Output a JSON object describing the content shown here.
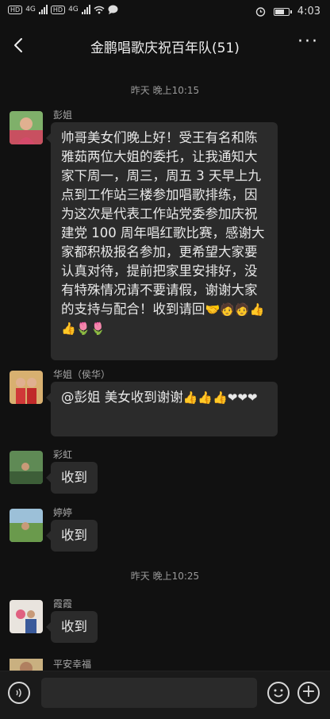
{
  "status_bar": {
    "sim1": "HD",
    "sim2": "HD",
    "network1": "4G",
    "network2": "4G",
    "time": "4:03",
    "icons": [
      "hd-icon",
      "signal-icon",
      "wifi-icon",
      "message-icon",
      "alarm-icon",
      "battery-icon"
    ]
  },
  "header": {
    "title": "金鹏唱歌庆祝百年队(51)",
    "back_icon": "chevron-left-icon",
    "more_label": "···"
  },
  "timestamps": [
    "昨天 晚上10:15",
    "昨天 晚上10:25"
  ],
  "messages": [
    {
      "sender": "彭姐",
      "text": "帅哥美女们晚上好！受王有名和陈雅茹两位大姐的委托，让我通知大家下周一，周三，周五 3 天早上九点到工作站三楼参加唱歌排练，因为这次是代表工作站党委参加庆祝建党 100 周年唱红歌比赛，感谢大家都积极报名参加，更希望大家要认真对待，提前把家里安排好，没有特殊情况请不要请假，谢谢大家的支持与配合！收到请回",
      "emoji": "🤝🧑🧑👍👍🌷🌷"
    },
    {
      "sender": "华姐（侯华）",
      "text": "@彭姐  美女收到谢谢",
      "emoji": "👍👍👍❤❤❤"
    },
    {
      "sender": "彩虹",
      "text": "收到"
    },
    {
      "sender": "婷婷",
      "text": "收到"
    },
    {
      "sender": "霞霞",
      "text": "收到"
    },
    {
      "sender": "平安幸福",
      "text": ""
    }
  ],
  "input": {
    "voice_icon": "voice-icon",
    "emoji_icon": "emoji-icon",
    "plus_icon": "plus-icon"
  },
  "colors": {
    "background": "#111111",
    "bubble": "#2b2b2b",
    "text": "#e8e8e8",
    "meta": "#9a9a9a"
  }
}
